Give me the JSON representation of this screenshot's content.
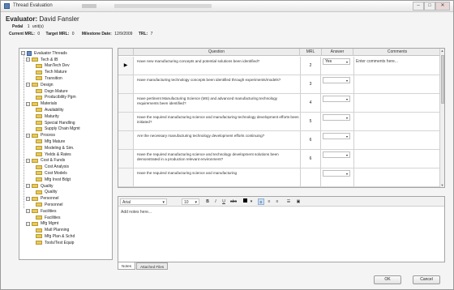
{
  "window": {
    "title": "Thread Evaluation",
    "buttons": {
      "minimize": "–",
      "maximize": "□",
      "close": "✕"
    }
  },
  "header": {
    "evaluator_label": "Evaluator:",
    "evaluator_name": "David Fansler",
    "pedal_label": "Pedal",
    "pedal_number": "1",
    "pedal_unit": "unit(s)",
    "current_mrl_label": "Current MRL:",
    "current_mrl_value": "0",
    "target_mrl_label": "Target MRL:",
    "target_mrl_value": "0",
    "milestone_label": "Milestone Date:",
    "milestone_value": "12/9/2009",
    "trl_label": "TRL:",
    "trl_value": "7"
  },
  "tree": {
    "root": "Evaluator Threads",
    "items": [
      {
        "label": "Tech & IB",
        "level": 1
      },
      {
        "label": "ManTech Dev",
        "level": 2
      },
      {
        "label": "Tech Mature",
        "level": 2
      },
      {
        "label": "Transition",
        "level": 2
      },
      {
        "label": "Design",
        "level": 1
      },
      {
        "label": "Dsgn Mature",
        "level": 2
      },
      {
        "label": "Producibility Pgm",
        "level": 2
      },
      {
        "label": "Materials",
        "level": 1
      },
      {
        "label": "Availability",
        "level": 2
      },
      {
        "label": "Maturity",
        "level": 2
      },
      {
        "label": "Special Handling",
        "level": 2
      },
      {
        "label": "Supply Chain Mgmt",
        "level": 2
      },
      {
        "label": "Process",
        "level": 1
      },
      {
        "label": "Mfg Mature",
        "level": 2
      },
      {
        "label": "Modeling & Sim.",
        "level": 2
      },
      {
        "label": "Yields & Rates",
        "level": 2
      },
      {
        "label": "Cost & Funds",
        "level": 1
      },
      {
        "label": "Cost Analysis",
        "level": 2
      },
      {
        "label": "Cost Models",
        "level": 2
      },
      {
        "label": "Mfg Invst Bdgt",
        "level": 2
      },
      {
        "label": "Quality",
        "level": 1
      },
      {
        "label": "Quality",
        "level": 2
      },
      {
        "label": "Personnel",
        "level": 1
      },
      {
        "label": "Personnel",
        "level": 2
      },
      {
        "label": "Facilities",
        "level": 1
      },
      {
        "label": "Facilities",
        "level": 2
      },
      {
        "label": "Mfg Mgmt",
        "level": 1
      },
      {
        "label": "Matl Planning",
        "level": 2
      },
      {
        "label": "Mfg Plan & Schd",
        "level": 2
      },
      {
        "label": "Tools/Test Equip",
        "level": 2
      }
    ]
  },
  "grid": {
    "headers": {
      "question": "Question",
      "mrl": "MRL",
      "answer": "Answer",
      "comments": "Comments"
    },
    "rows": [
      {
        "question": "Have new manufacturing concepts and potential solutions been identified?",
        "mrl": "2",
        "answer": "Yes",
        "comment": "Enter comments here...",
        "current": true
      },
      {
        "question": "Have manufacturing technology concepts been identified through experiments/models?",
        "mrl": "3",
        "answer": "",
        "comment": "",
        "current": false
      },
      {
        "question": "Have pertinent Manufacturing Science (MS) and advanced manufacturing technology requirements been identified?",
        "mrl": "4",
        "answer": "",
        "comment": "",
        "current": false
      },
      {
        "question": "Have the required manufacturing science and manufacturing technology development efforts been initiated?",
        "mrl": "5",
        "answer": "",
        "comment": "",
        "current": false
      },
      {
        "question": "Are the necessary manufacturing technology development efforts continuing?",
        "mrl": "6",
        "answer": "",
        "comment": "",
        "current": false
      },
      {
        "question": "Have the required manufacturing science and technology development solutions been demonstrated in a production relevant environment?",
        "mrl": "6",
        "answer": "",
        "comment": "",
        "current": false
      },
      {
        "question": "Have the required manufacturing science and manufacturing",
        "mrl": "",
        "answer": "",
        "comment": "",
        "current": false
      }
    ],
    "current_marker": "▶",
    "dropdown_glyph": "▾"
  },
  "editor": {
    "font": "Arial",
    "size": "10",
    "bold": "B",
    "italic": "I",
    "underline": "U",
    "strike": "abc",
    "notes_placeholder": "Add notes here..."
  },
  "tabs": [
    "Notes",
    "Attached Files"
  ],
  "footer": {
    "ok": "OK",
    "cancel": "Cancel"
  }
}
